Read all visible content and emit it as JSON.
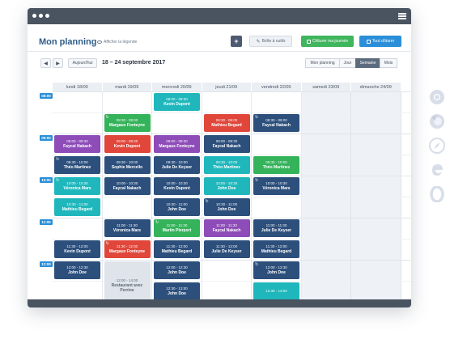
{
  "window": {
    "title": ""
  },
  "header": {
    "title": "Mon planning",
    "legend_link": "Afficher la légende",
    "add_label": "+",
    "tools_label": "Boîte à outils",
    "close_day_label": "Clôturer ma journée",
    "close_all_label": "Tout clôturer"
  },
  "toolbar": {
    "prev": "◀",
    "next": "▶",
    "today": "Aujourd'hui",
    "range": "18 – 24 septembre 2017",
    "views": [
      "Mon planning",
      "Jour",
      "Semaine",
      "Mois"
    ],
    "active_view": "Semaine"
  },
  "days": [
    "lundi 18/09",
    "mardi 19/09",
    "mercredi 20/09",
    "jeudi 21/09",
    "vendredi 22/09",
    "samedi 23/09",
    "dimanche 24/09"
  ],
  "time_labels": [
    "08:00",
    "09:00",
    "10:00",
    "11:00",
    "12:00"
  ],
  "events": [
    {
      "day": 2,
      "slot": 0,
      "time": "08:00 - 08:30",
      "name": "Kevin Dupont",
      "color": "teal",
      "repeat": false
    },
    {
      "day": 1,
      "slot": 1,
      "time": "08:30 - 09:00",
      "name": "Margaux Fonteyne",
      "color": "green",
      "repeat": true
    },
    {
      "day": 3,
      "slot": 1,
      "time": "08:30 - 09:00",
      "name": "Mathieu Begard",
      "color": "red",
      "repeat": false
    },
    {
      "day": 4,
      "slot": 1,
      "time": "08:30 - 09:00",
      "name": "Faycal Nakach",
      "color": "navy",
      "repeat": true
    },
    {
      "day": 0,
      "slot": 2,
      "time": "09:00 - 09:30",
      "name": "Faycal Nakach",
      "color": "purple",
      "repeat": false
    },
    {
      "day": 1,
      "slot": 2,
      "time": "09:00 - 09:30",
      "name": "Kevin Dupont",
      "color": "red",
      "repeat": false
    },
    {
      "day": 2,
      "slot": 2,
      "time": "09:00 - 09:30",
      "name": "Margaux Fonteyne",
      "color": "purple",
      "repeat": false
    },
    {
      "day": 3,
      "slot": 2,
      "time": "09:00 - 09:30",
      "name": "Faycal Nakach",
      "color": "navy",
      "repeat": false
    },
    {
      "day": 0,
      "slot": 3,
      "time": "09:30 - 10:00",
      "name": "Théo Martinez",
      "color": "navy",
      "repeat": true
    },
    {
      "day": 1,
      "slot": 3,
      "time": "09:30 - 10:00",
      "name": "Sophie Mercello",
      "color": "navy",
      "repeat": false
    },
    {
      "day": 2,
      "slot": 3,
      "time": "09:30 - 10:00",
      "name": "Julie De Keyser",
      "color": "navy",
      "repeat": false
    },
    {
      "day": 3,
      "slot": 3,
      "time": "09:30 - 10:00",
      "name": "Théo Martinez",
      "color": "teal",
      "repeat": false
    },
    {
      "day": 4,
      "slot": 3,
      "time": "09:30 - 10:00",
      "name": "Théo Martinez",
      "color": "green",
      "repeat": false
    },
    {
      "day": 0,
      "slot": 4,
      "time": "10:00 - 10:30",
      "name": "Véronica Mars",
      "color": "teal",
      "repeat": true
    },
    {
      "day": 1,
      "slot": 4,
      "time": "10:00 - 10:30",
      "name": "Faycal Nakach",
      "color": "navy",
      "repeat": false
    },
    {
      "day": 2,
      "slot": 4,
      "time": "10:00 - 10:30",
      "name": "Kevin Dupont",
      "color": "navy",
      "repeat": false
    },
    {
      "day": 3,
      "slot": 4,
      "time": "10:00 - 10:30",
      "name": "John Doe",
      "color": "teal",
      "repeat": false
    },
    {
      "day": 4,
      "slot": 4,
      "time": "10:00 - 10:30",
      "name": "Véronica Mars",
      "color": "navy",
      "repeat": true
    },
    {
      "day": 0,
      "slot": 5,
      "time": "10:30 - 11:00",
      "name": "Mathieu Begard",
      "color": "teal",
      "repeat": false
    },
    {
      "day": 2,
      "slot": 5,
      "time": "10:30 - 11:00",
      "name": "John Doe",
      "color": "navy",
      "repeat": false
    },
    {
      "day": 3,
      "slot": 5,
      "time": "10:30 - 11:00",
      "name": "John Doe",
      "color": "navy",
      "repeat": true
    },
    {
      "day": 1,
      "slot": 6,
      "time": "11:00 - 11:30",
      "name": "Véronica Mars",
      "color": "navy",
      "repeat": false
    },
    {
      "day": 2,
      "slot": 6,
      "time": "11:00 - 11:30",
      "name": "Martin Pierport",
      "color": "green",
      "repeat": true
    },
    {
      "day": 3,
      "slot": 6,
      "time": "11:00 - 11:30",
      "name": "Faycal Nakach",
      "color": "purple",
      "repeat": false
    },
    {
      "day": 4,
      "slot": 6,
      "time": "11:00 - 11:30",
      "name": "Julie De Keyser",
      "color": "navy",
      "repeat": false
    },
    {
      "day": 0,
      "slot": 7,
      "time": "11:30 - 12:00",
      "name": "Kevin Dupont",
      "color": "navy",
      "repeat": false
    },
    {
      "day": 1,
      "slot": 7,
      "time": "11:30 - 12:00",
      "name": "Margaux Fonteyne",
      "color": "red",
      "repeat": true
    },
    {
      "day": 2,
      "slot": 7,
      "time": "11:30 - 12:00",
      "name": "Mathieu Begard",
      "color": "navy",
      "repeat": false
    },
    {
      "day": 3,
      "slot": 7,
      "time": "11:30 - 12:00",
      "name": "Julie De Keyser",
      "color": "navy",
      "repeat": false
    },
    {
      "day": 4,
      "slot": 7,
      "time": "11:30 - 12:00",
      "name": "Mathieu Begard",
      "color": "navy",
      "repeat": false
    },
    {
      "day": 0,
      "slot": 8,
      "time": "12:00 - 12:30",
      "name": "John Doe",
      "color": "navy",
      "repeat": false
    },
    {
      "day": 1,
      "slot": 8,
      "time": "12:00 - 14:00",
      "name": "Restaurant avec Perrine",
      "color": "gray",
      "repeat": false,
      "tall": true
    },
    {
      "day": 2,
      "slot": 8,
      "time": "12:00 - 12:30",
      "name": "John Doe",
      "color": "navy",
      "repeat": false
    },
    {
      "day": 4,
      "slot": 8,
      "time": "12:00 - 12:30",
      "name": "John Doe",
      "color": "navy",
      "repeat": true
    },
    {
      "day": 2,
      "slot": 9,
      "time": "12:30 - 13:00",
      "name": "John Doe",
      "color": "navy",
      "repeat": false
    },
    {
      "day": 4,
      "slot": 9,
      "time": "12:30 - 13:00",
      "name": "",
      "color": "teal",
      "repeat": false
    }
  ],
  "colors": {
    "navy": "#2c4f7c",
    "teal": "#1fb7bc",
    "purple": "#8e4cb8",
    "red": "#e0463a",
    "green": "#34b35a",
    "accent": "#2a8fd8",
    "frame": "#4a5360"
  },
  "side_icons": [
    "chrome-icon",
    "firefox-icon",
    "safari-icon",
    "edge-icon",
    "opera-icon"
  ]
}
